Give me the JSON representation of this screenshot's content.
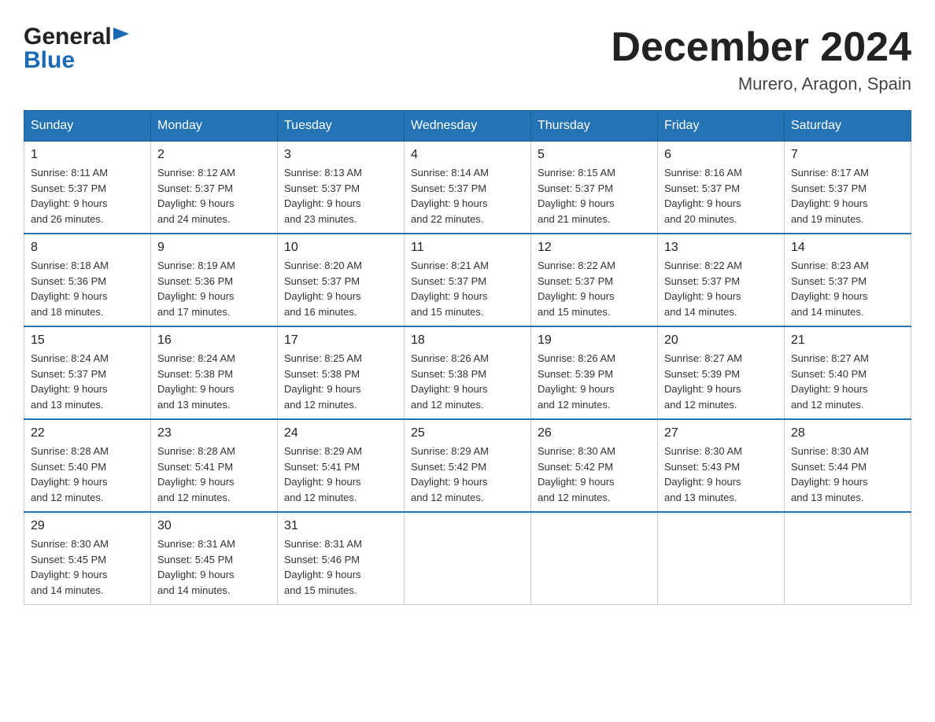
{
  "header": {
    "logo_general": "General",
    "logo_blue": "Blue",
    "month_title": "December 2024",
    "location": "Murero, Aragon, Spain"
  },
  "columns": [
    "Sunday",
    "Monday",
    "Tuesday",
    "Wednesday",
    "Thursday",
    "Friday",
    "Saturday"
  ],
  "weeks": [
    [
      {
        "day": "1",
        "sunrise": "8:11 AM",
        "sunset": "5:37 PM",
        "daylight": "9 hours and 26 minutes."
      },
      {
        "day": "2",
        "sunrise": "8:12 AM",
        "sunset": "5:37 PM",
        "daylight": "9 hours and 24 minutes."
      },
      {
        "day": "3",
        "sunrise": "8:13 AM",
        "sunset": "5:37 PM",
        "daylight": "9 hours and 23 minutes."
      },
      {
        "day": "4",
        "sunrise": "8:14 AM",
        "sunset": "5:37 PM",
        "daylight": "9 hours and 22 minutes."
      },
      {
        "day": "5",
        "sunrise": "8:15 AM",
        "sunset": "5:37 PM",
        "daylight": "9 hours and 21 minutes."
      },
      {
        "day": "6",
        "sunrise": "8:16 AM",
        "sunset": "5:37 PM",
        "daylight": "9 hours and 20 minutes."
      },
      {
        "day": "7",
        "sunrise": "8:17 AM",
        "sunset": "5:37 PM",
        "daylight": "9 hours and 19 minutes."
      }
    ],
    [
      {
        "day": "8",
        "sunrise": "8:18 AM",
        "sunset": "5:36 PM",
        "daylight": "9 hours and 18 minutes."
      },
      {
        "day": "9",
        "sunrise": "8:19 AM",
        "sunset": "5:36 PM",
        "daylight": "9 hours and 17 minutes."
      },
      {
        "day": "10",
        "sunrise": "8:20 AM",
        "sunset": "5:37 PM",
        "daylight": "9 hours and 16 minutes."
      },
      {
        "day": "11",
        "sunrise": "8:21 AM",
        "sunset": "5:37 PM",
        "daylight": "9 hours and 15 minutes."
      },
      {
        "day": "12",
        "sunrise": "8:22 AM",
        "sunset": "5:37 PM",
        "daylight": "9 hours and 15 minutes."
      },
      {
        "day": "13",
        "sunrise": "8:22 AM",
        "sunset": "5:37 PM",
        "daylight": "9 hours and 14 minutes."
      },
      {
        "day": "14",
        "sunrise": "8:23 AM",
        "sunset": "5:37 PM",
        "daylight": "9 hours and 14 minutes."
      }
    ],
    [
      {
        "day": "15",
        "sunrise": "8:24 AM",
        "sunset": "5:37 PM",
        "daylight": "9 hours and 13 minutes."
      },
      {
        "day": "16",
        "sunrise": "8:24 AM",
        "sunset": "5:38 PM",
        "daylight": "9 hours and 13 minutes."
      },
      {
        "day": "17",
        "sunrise": "8:25 AM",
        "sunset": "5:38 PM",
        "daylight": "9 hours and 12 minutes."
      },
      {
        "day": "18",
        "sunrise": "8:26 AM",
        "sunset": "5:38 PM",
        "daylight": "9 hours and 12 minutes."
      },
      {
        "day": "19",
        "sunrise": "8:26 AM",
        "sunset": "5:39 PM",
        "daylight": "9 hours and 12 minutes."
      },
      {
        "day": "20",
        "sunrise": "8:27 AM",
        "sunset": "5:39 PM",
        "daylight": "9 hours and 12 minutes."
      },
      {
        "day": "21",
        "sunrise": "8:27 AM",
        "sunset": "5:40 PM",
        "daylight": "9 hours and 12 minutes."
      }
    ],
    [
      {
        "day": "22",
        "sunrise": "8:28 AM",
        "sunset": "5:40 PM",
        "daylight": "9 hours and 12 minutes."
      },
      {
        "day": "23",
        "sunrise": "8:28 AM",
        "sunset": "5:41 PM",
        "daylight": "9 hours and 12 minutes."
      },
      {
        "day": "24",
        "sunrise": "8:29 AM",
        "sunset": "5:41 PM",
        "daylight": "9 hours and 12 minutes."
      },
      {
        "day": "25",
        "sunrise": "8:29 AM",
        "sunset": "5:42 PM",
        "daylight": "9 hours and 12 minutes."
      },
      {
        "day": "26",
        "sunrise": "8:30 AM",
        "sunset": "5:42 PM",
        "daylight": "9 hours and 12 minutes."
      },
      {
        "day": "27",
        "sunrise": "8:30 AM",
        "sunset": "5:43 PM",
        "daylight": "9 hours and 13 minutes."
      },
      {
        "day": "28",
        "sunrise": "8:30 AM",
        "sunset": "5:44 PM",
        "daylight": "9 hours and 13 minutes."
      }
    ],
    [
      {
        "day": "29",
        "sunrise": "8:30 AM",
        "sunset": "5:45 PM",
        "daylight": "9 hours and 14 minutes."
      },
      {
        "day": "30",
        "sunrise": "8:31 AM",
        "sunset": "5:45 PM",
        "daylight": "9 hours and 14 minutes."
      },
      {
        "day": "31",
        "sunrise": "8:31 AM",
        "sunset": "5:46 PM",
        "daylight": "9 hours and 15 minutes."
      },
      null,
      null,
      null,
      null
    ]
  ]
}
